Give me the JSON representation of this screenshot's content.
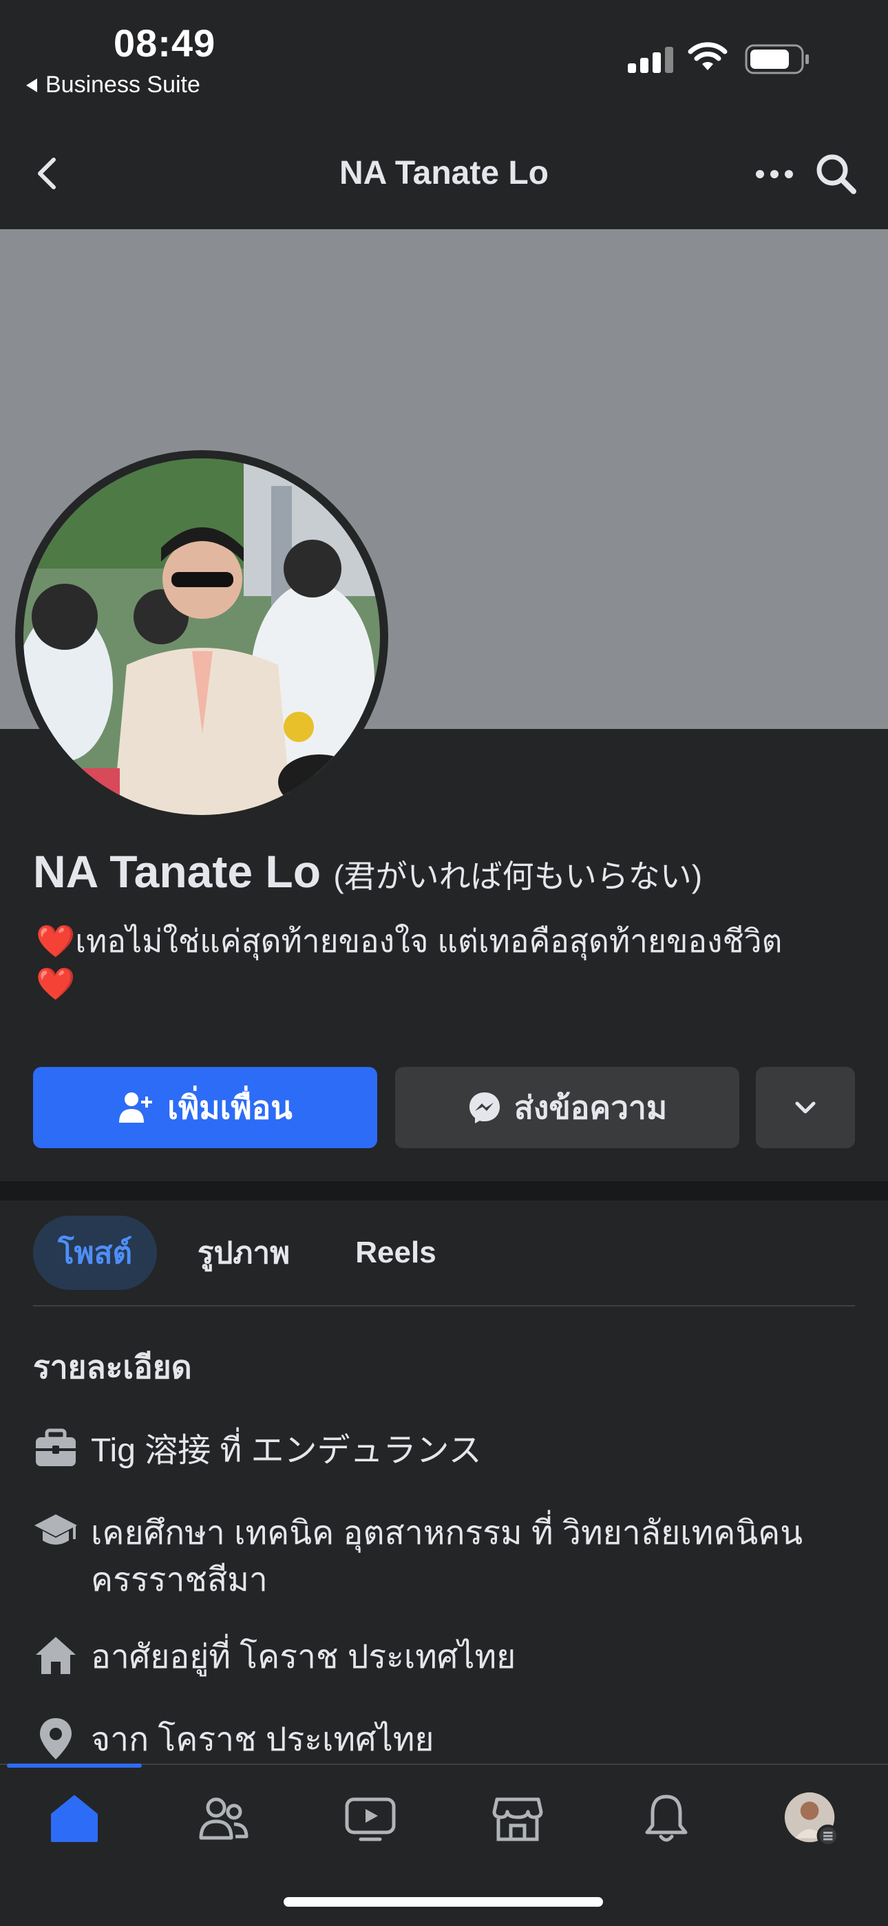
{
  "status_bar": {
    "time": "08:49",
    "back_app": "Business Suite"
  },
  "nav": {
    "title": "NA Tanate Lo"
  },
  "profile": {
    "name": "NA Tanate Lo",
    "alt_name": "(君がいれば何もいらない)",
    "bio_heart": "❤️",
    "bio_text": "เทอไม่ใช่แค่สุดท้ายของใจ แต่เทอคือสุดท้ายของชีวิต",
    "bio_heart_end": "❤️"
  },
  "actions": {
    "add_friend": "เพิ่มเพื่อน",
    "message": "ส่งข้อความ"
  },
  "tabs": [
    {
      "label": "โพสต์",
      "selected": true
    },
    {
      "label": "รูปภาพ",
      "selected": false
    },
    {
      "label": "Reels",
      "selected": false
    }
  ],
  "details": {
    "title": "รายละเอียด",
    "items": [
      {
        "icon": "briefcase-icon",
        "text": "Tig 溶接 ที่ エンデュランス"
      },
      {
        "icon": "graduation-cap-icon",
        "text": "เคยศึกษา เทคนิค อุตสาหกรรม ที่ วิทยาลัยเทคนิคนครรราชสีมา"
      },
      {
        "icon": "home-icon",
        "text": "อาศัยอยู่ที่ โคราช ประเทศไทย"
      },
      {
        "icon": "location-pin-icon",
        "text": "จาก โคราช ประเทศไทย"
      }
    ]
  },
  "bottom_nav": [
    {
      "icon": "home-icon",
      "active": true
    },
    {
      "icon": "friends-icon",
      "active": false
    },
    {
      "icon": "video-icon",
      "active": false
    },
    {
      "icon": "marketplace-icon",
      "active": false
    },
    {
      "icon": "bell-icon",
      "active": false
    },
    {
      "icon": "profile-menu-icon",
      "active": false
    }
  ],
  "colors": {
    "background": "#242526",
    "accent": "#2d6cf6",
    "cover": "#8a8d91",
    "tab_selected_bg": "#263951",
    "tab_selected_text": "#4f8ef7"
  }
}
